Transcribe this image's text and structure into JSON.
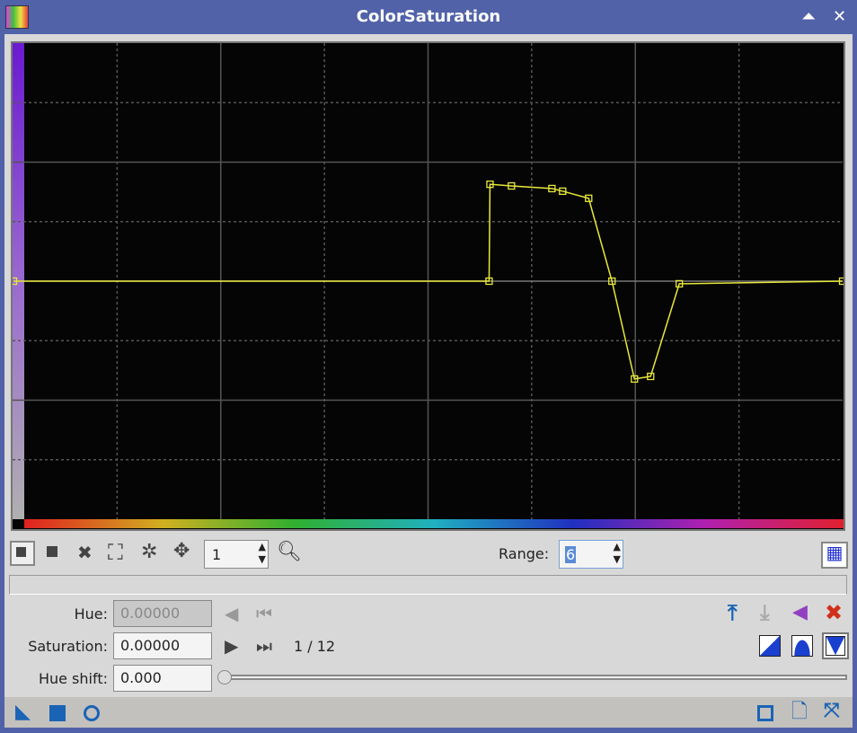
{
  "window": {
    "title": "ColorSaturation"
  },
  "toolbar": {
    "zoom_value": "1",
    "range_label": "Range:",
    "range_value": "6"
  },
  "fields": {
    "hue_label": "Hue:",
    "hue_value": "0.00000",
    "saturation_label": "Saturation:",
    "saturation_value": "0.00000",
    "point_counter": "1 / 12",
    "hue_shift_label": "Hue shift:",
    "hue_shift_value": "0.000"
  },
  "hue_shift_slider": {
    "value": 0
  },
  "colors": {
    "curve": "#e8e83a",
    "title_bar": "#5162a9",
    "accent_blue": "#1a63b5",
    "delete_red": "#d0301a"
  },
  "chart_data": {
    "type": "line",
    "xlabel": "",
    "ylabel": "",
    "xlim": [
      0,
      1
    ],
    "ylim": [
      -1,
      1
    ],
    "grid": true,
    "x": [
      0,
      0.5736,
      0.5747,
      0.6006,
      0.6494,
      0.6623,
      0.6937,
      0.7218,
      0.7489,
      0.7684,
      0.803,
      1
    ],
    "y": [
      0,
      0,
      0.407,
      0.4,
      0.389,
      0.378,
      0.348,
      0,
      -0.411,
      -0.4,
      -0.011,
      0
    ],
    "selected_point": 1
  }
}
